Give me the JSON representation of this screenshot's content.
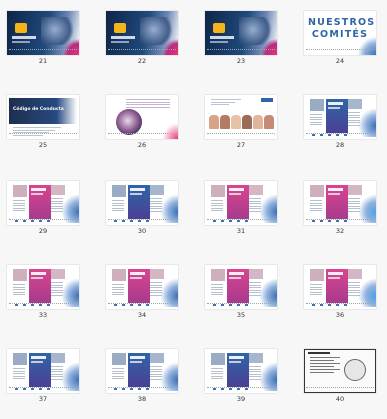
{
  "thumbnails": [
    {
      "page": "21",
      "kind": "banner-dark"
    },
    {
      "page": "22",
      "kind": "banner-dark2"
    },
    {
      "page": "23",
      "kind": "banner-dark3"
    },
    {
      "page": "24",
      "kind": "title",
      "title_lines": [
        "NUESTROS",
        "COMITÉS"
      ]
    },
    {
      "page": "25",
      "kind": "code"
    },
    {
      "page": "26",
      "kind": "doc-image"
    },
    {
      "page": "27",
      "kind": "people"
    },
    {
      "page": "28",
      "kind": "brochure-blue"
    },
    {
      "page": "29",
      "kind": "brochure-pink"
    },
    {
      "page": "30",
      "kind": "brochure-blue"
    },
    {
      "page": "31",
      "kind": "brochure-pink"
    },
    {
      "page": "32",
      "kind": "brochure-pink2"
    },
    {
      "page": "33",
      "kind": "brochure-pink"
    },
    {
      "page": "34",
      "kind": "brochure-pink"
    },
    {
      "page": "35",
      "kind": "brochure-pink"
    },
    {
      "page": "36",
      "kind": "brochure-pink2"
    },
    {
      "page": "37",
      "kind": "brochure-blue"
    },
    {
      "page": "38",
      "kind": "brochure-blue"
    },
    {
      "page": "39",
      "kind": "brochure-blue"
    },
    {
      "page": "40",
      "kind": "doc-scan"
    }
  ],
  "code_banner": {
    "title": "Código de Conducta"
  },
  "colors": {
    "blue": "#2e66a8",
    "pink": "#d8458f",
    "dark": "#1d2f4f",
    "accent": "#e8337a"
  }
}
